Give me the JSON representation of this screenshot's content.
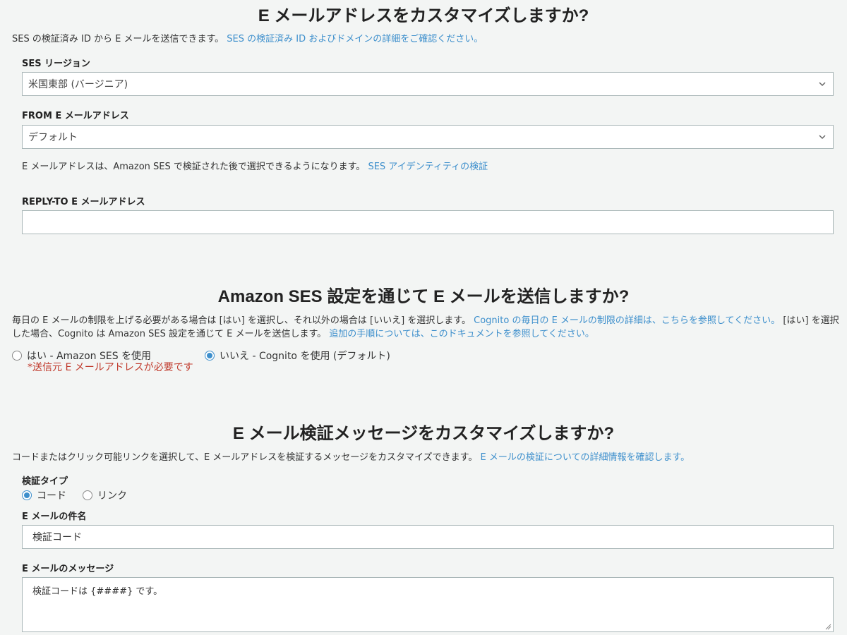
{
  "email_address": {
    "title": "E メールアドレスをカスタマイズしますか?",
    "description": "SES の検証済み ID から E メールを送信できます。",
    "description_link": "SES の検証済み ID およびドメインの詳細をご確認ください。",
    "ses_region_label": "SES リージョン",
    "ses_region_value": "米国東部 (バージニア)",
    "from_label": "FROM E メールアドレス",
    "from_value": "デフォルト",
    "from_help": "E メールアドレスは、Amazon SES で検証された後で選択できるようになります。",
    "from_help_link": "SES アイデンティティの検証",
    "reply_to_label": "REPLY-TO E メールアドレス",
    "reply_to_value": ""
  },
  "ses_sending": {
    "title": "Amazon SES 設定を通じて E メールを送信しますか?",
    "desc_part1": "毎日の E メールの制限を上げる必要がある場合は [はい] を選択し、それ以外の場合は [いいえ] を選択します。",
    "desc_link1": "Cognito の毎日の E メールの制限の詳細は、こちらを参照してください。",
    "desc_part2": "[はい] を選択した場合、Cognito は Amazon SES 設定を通じて E メールを送信します。",
    "desc_link2": "追加の手順については、このドキュメントを参照してください。",
    "option_yes": "はい - Amazon SES を使用",
    "option_yes_note": "*送信元 E メールアドレスが必要です",
    "option_no": "いいえ - Cognito を使用 (デフォルト)",
    "selected": "no"
  },
  "verification": {
    "title": "E メール検証メッセージをカスタマイズしますか?",
    "description": "コードまたはクリック可能リンクを選択して、E メールアドレスを検証するメッセージをカスタマイズできます。",
    "description_link": "E メールの検証についての詳細情報を確認します。",
    "type_label": "検証タイプ",
    "type_code": "コード",
    "type_link": "リンク",
    "selected_type": "code",
    "subject_label": "E メールの件名",
    "subject_value": "検証コード",
    "message_label": "E メールのメッセージ",
    "message_value": "検証コードは {####} です。"
  },
  "icons": {
    "dropdown": "chevron-down-icon",
    "resize": "resize-grip-icon"
  },
  "colors": {
    "link": "#3d8fcc",
    "required_note": "#c0392b",
    "background": "#f3f5f4"
  }
}
